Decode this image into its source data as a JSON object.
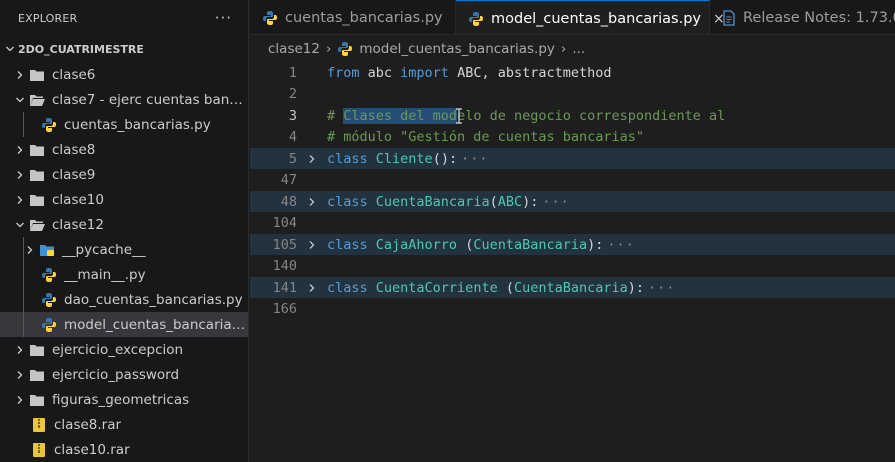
{
  "colors": {
    "accent": "#0078d4",
    "folder": "#c5c5c5",
    "python_blue": "#3776ab",
    "python_yellow": "#ffd43b",
    "rar": "#e8c53a"
  },
  "explorer": {
    "title": "EXPLORER",
    "more": "···",
    "root": "2DO_CUATRIMESTRE",
    "items": [
      {
        "label": "clase6",
        "icon": "folder-icon",
        "expanded": false
      },
      {
        "label": "clase7 - ejerc cuentas banc...",
        "icon": "folder-open-icon",
        "expanded": true
      },
      {
        "label": "cuentas_bancarias.py",
        "icon": "python-file-icon"
      },
      {
        "label": "clase8",
        "icon": "folder-icon",
        "expanded": false
      },
      {
        "label": "clase9",
        "icon": "folder-icon",
        "expanded": false
      },
      {
        "label": "clase10",
        "icon": "folder-icon",
        "expanded": false
      },
      {
        "label": "clase12",
        "icon": "folder-open-icon",
        "expanded": true
      },
      {
        "label": "__pycache__",
        "icon": "pycache-folder-icon",
        "expanded": false
      },
      {
        "label": "__main__.py",
        "icon": "python-file-icon"
      },
      {
        "label": "dao_cuentas_bancarias.py",
        "icon": "python-file-icon"
      },
      {
        "label": "model_cuentas_bancarias....",
        "icon": "python-file-icon",
        "selected": true
      },
      {
        "label": "ejercicio_excepcion",
        "icon": "folder-icon",
        "expanded": false
      },
      {
        "label": "ejercicio_password",
        "icon": "folder-icon",
        "expanded": false
      },
      {
        "label": "figuras_geometricas",
        "icon": "folder-icon",
        "expanded": false
      },
      {
        "label": "clase8.rar",
        "icon": "archive-file-icon"
      },
      {
        "label": "clase10.rar",
        "icon": "archive-file-icon"
      }
    ]
  },
  "tabs": [
    {
      "label": "cuentas_bancarias.py",
      "icon": "python-file-icon",
      "active": false
    },
    {
      "label": "model_cuentas_bancarias.py",
      "icon": "python-file-icon",
      "active": true,
      "close": "×"
    },
    {
      "label": "Release Notes: 1.73.0",
      "icon": "document-icon",
      "active": false
    }
  ],
  "breadcrumb": {
    "folder": "clase12",
    "sep": "›",
    "file": "model_cuentas_bancarias.py",
    "tail": "..."
  },
  "editor": {
    "lines": [
      {
        "num": "1"
      },
      {
        "num": "2"
      },
      {
        "num": "3"
      },
      {
        "num": "4"
      },
      {
        "num": "5"
      },
      {
        "num": "47"
      },
      {
        "num": "48"
      },
      {
        "num": "104"
      },
      {
        "num": "105"
      },
      {
        "num": "140"
      },
      {
        "num": "141"
      },
      {
        "num": "166"
      }
    ],
    "code": {
      "l1_kw1": "from",
      "l1_mod": " abc ",
      "l1_kw2": "import",
      "l1_rest": " ABC, abstractmethod",
      "l3_hash": "# ",
      "l3_sel": "Clases del mod",
      "l3_rest": "elo de negocio correspondiente al",
      "l4": "# módulo \"Gestión de cuentas bancarias\"",
      "l5_kw": "class",
      "l5_name": "Cliente",
      "l5_rest": "():",
      "l48_kw": "class",
      "l48_name": "CuentaBancaria",
      "l48_p1": "(",
      "l48_base": "ABC",
      "l48_p2": "):",
      "l105_kw": "class",
      "l105_name": "CajaAhorro",
      "l105_p1": " (",
      "l105_base": "CuentaBancaria",
      "l105_p2": "):",
      "l141_kw": "class",
      "l141_name": "CuentaCorriente",
      "l141_p1": " (",
      "l141_base": "CuentaBancaria",
      "l141_p2": "):",
      "fold_dots": "···"
    }
  }
}
